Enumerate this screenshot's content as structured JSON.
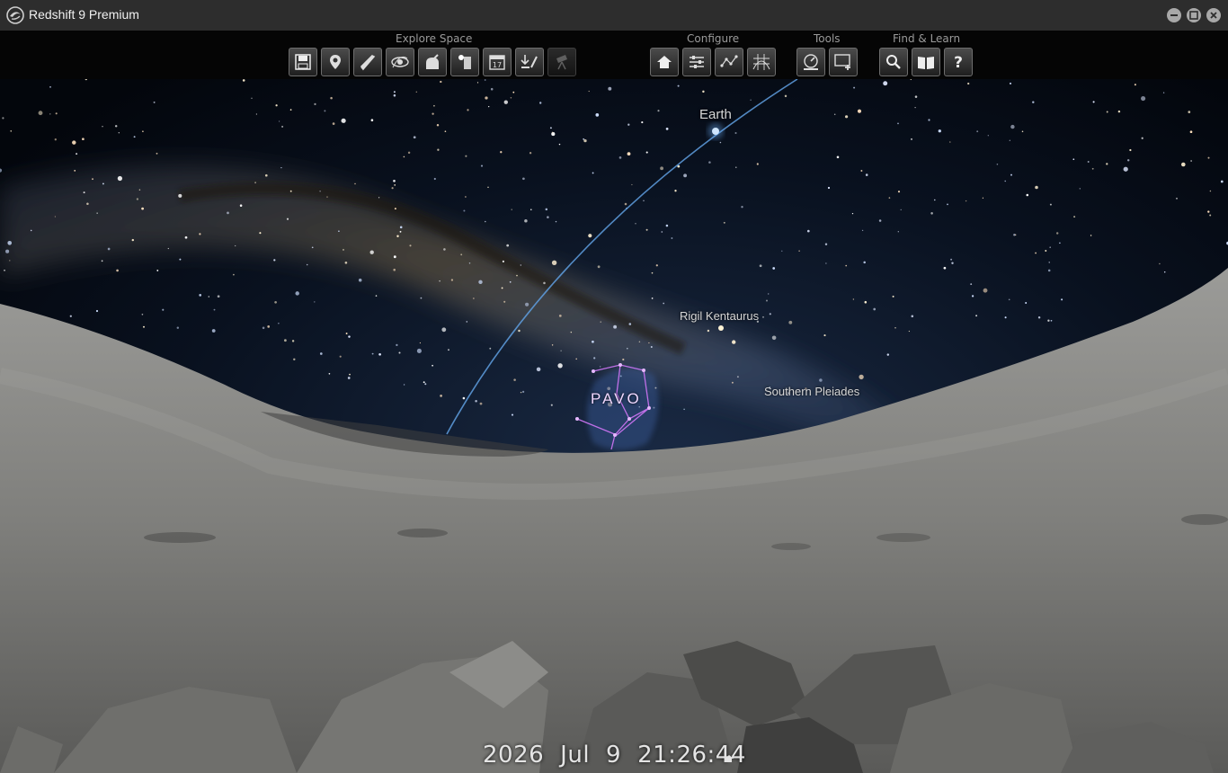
{
  "window": {
    "title": "Redshift 9 Premium"
  },
  "toolbar": {
    "groups": [
      {
        "label": "Explore Space"
      },
      {
        "label": "Configure"
      },
      {
        "label": "Tools"
      },
      {
        "label": "Find & Learn"
      }
    ]
  },
  "sky": {
    "labels": {
      "earth": "Earth",
      "rigil": "Rigil Kentaurus",
      "pleiades": "Southern Pleiades",
      "pavo": "PAVO"
    }
  },
  "datetime": {
    "year": "2026",
    "month": "Jul",
    "day": "9",
    "time": "21:26:44"
  },
  "colors": {
    "sky": "#040810",
    "ground": "#8a8a88",
    "orbit": "#5f9fe0",
    "constellation": "#c070e8"
  }
}
